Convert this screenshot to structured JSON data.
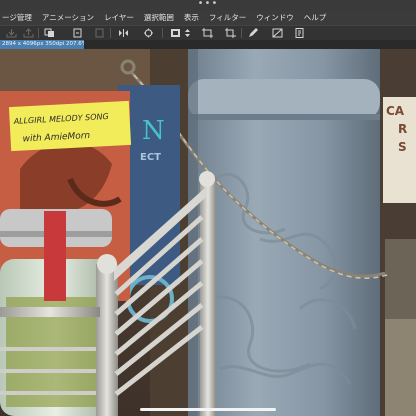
{
  "app": {
    "handle_dots": "•••"
  },
  "menubar": {
    "items": [
      "ージ管理",
      "アニメーション",
      "レイヤー",
      "選択範囲",
      "表示",
      "フィルター",
      "ウィンドウ",
      "ヘルプ"
    ]
  },
  "toolbar": {
    "icons": [
      "save-icon",
      "export-icon",
      "layer-copy-icon",
      "flip-horizontal-icon",
      "rotate-icon",
      "fill-icon",
      "transparency-icon",
      "transform-icon",
      "crop-icon",
      "pen-icon",
      "adjust-icon",
      "document-icon"
    ]
  },
  "canvas_tab": {
    "label": "2894 x 4096px 350dpi 207.6%)"
  },
  "artwork": {
    "sticky_note_line1": "ALLGIRL MELODY SONG",
    "sticky_note_line2": "with AmieMorn",
    "poster_letter": "N",
    "poster_word": "ECT",
    "sign_letters": [
      "CA",
      "R",
      "S"
    ]
  },
  "colors": {
    "menubar_bg": "#3b3b3b",
    "toolbar_bg": "#333333",
    "tab_accent": "#4a7fb2",
    "pillar": "#8a99a7",
    "sticky_note": "#f2ec5a",
    "jar_lid_band": "#c8393b"
  }
}
